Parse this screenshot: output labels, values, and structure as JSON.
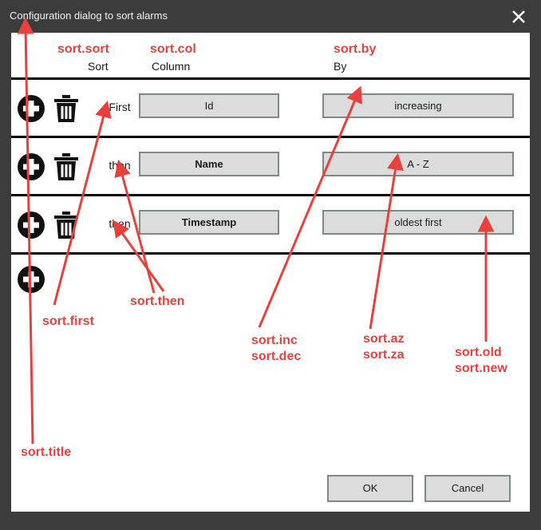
{
  "window": {
    "title": "Configuration dialog to sort alarms",
    "close_icon": "close-x-icon",
    "title_bar_color": "#3c3c3c",
    "body_color": "#ffffff"
  },
  "columns": {
    "sort": "Sort",
    "column": "Column",
    "by": "By"
  },
  "rows": [
    {
      "order": "First",
      "add_icon": "plus-circle-icon",
      "delete_icon": "trash-icon",
      "column_value": "Id",
      "by_value": "increasing",
      "column_bold": false,
      "has_delete": true
    },
    {
      "order": "then",
      "add_icon": "plus-circle-icon",
      "delete_icon": "trash-icon",
      "column_value": "Name",
      "by_value": "A - Z",
      "column_bold": true,
      "has_delete": true
    },
    {
      "order": "then",
      "add_icon": "plus-circle-icon",
      "delete_icon": "trash-icon",
      "column_value": "Timestamp",
      "by_value": "oldest first",
      "column_bold": true,
      "has_delete": true
    },
    {
      "order": "",
      "add_icon": "plus-circle-icon",
      "delete_icon": "",
      "column_value": "",
      "by_value": "",
      "column_bold": false,
      "has_delete": false
    }
  ],
  "footer": {
    "ok_label": "OK",
    "cancel_label": "Cancel"
  },
  "annotations": {
    "color": "#e8413d",
    "items": [
      {
        "key": "sort_sort",
        "text": "sort.sort"
      },
      {
        "key": "sort_col",
        "text": "sort.col"
      },
      {
        "key": "sort_by",
        "text": "sort.by"
      },
      {
        "key": "sort_first",
        "text": "sort.first"
      },
      {
        "key": "sort_then",
        "text": "sort.then"
      },
      {
        "key": "sort_title",
        "text": "sort.title"
      },
      {
        "key": "sort_incdec",
        "text": "sort.inc\nsort.dec"
      },
      {
        "key": "sort_azza",
        "text": "sort.az\nsort.za"
      },
      {
        "key": "sort_oldnew",
        "text": "sort.old\nsort.new"
      }
    ]
  }
}
